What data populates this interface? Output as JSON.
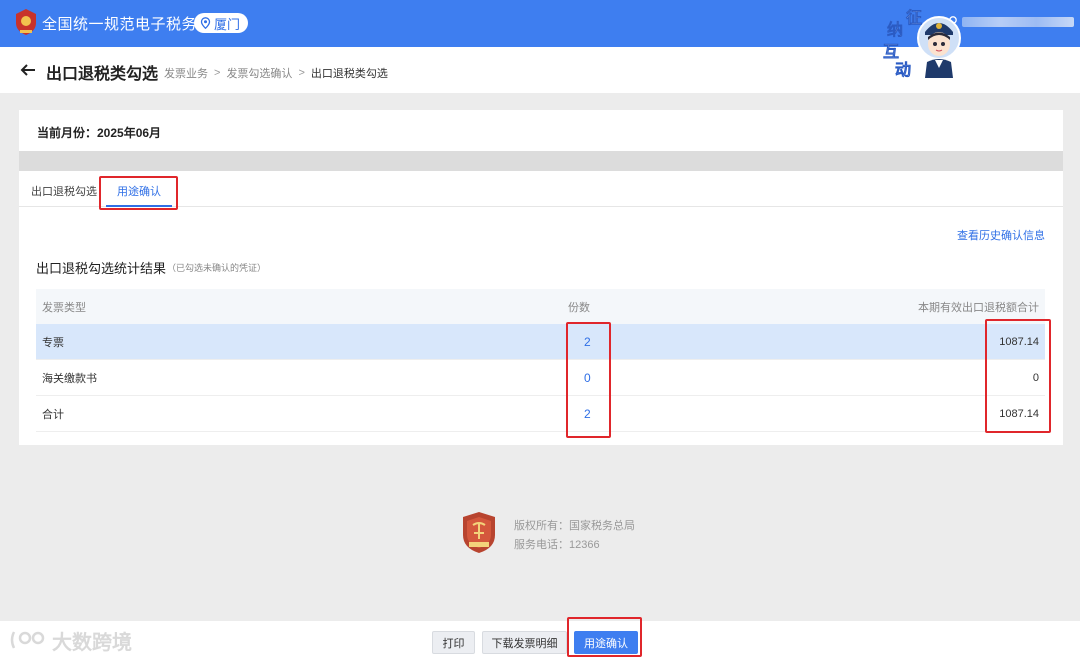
{
  "header": {
    "site_title": "全国统一规范电子税务局",
    "city": "厦门",
    "mascot_chars": [
      "征",
      "纳",
      "互",
      "动"
    ]
  },
  "page": {
    "title": "出口退税类勾选",
    "breadcrumb": [
      "发票业务",
      "发票勾选确认",
      "出口退税类勾选"
    ],
    "breadcrumb_sep": ">"
  },
  "month": {
    "label": "当前月份：2025年06月"
  },
  "tabs": [
    {
      "label": "出口退税勾选",
      "active": false
    },
    {
      "label": "用途确认",
      "active": true
    }
  ],
  "content": {
    "history_link": "查看历史确认信息",
    "stats_title": "出口退税勾选统计结果",
    "stats_subtitle": "（已勾选未确认的凭证）",
    "table": {
      "headers": [
        "发票类型",
        "份数",
        "本期有效出口退税额合计"
      ],
      "rows": [
        {
          "type": "专票",
          "count": "2",
          "amount": "1087.14",
          "selected": true
        },
        {
          "type": "海关缴款书",
          "count": "0",
          "amount": "0",
          "selected": false
        },
        {
          "type": "合计",
          "count": "2",
          "amount": "1087.14",
          "selected": false
        }
      ]
    }
  },
  "footer": {
    "copyright": "版权所有：国家税务总局",
    "phone": "服务电话：12366"
  },
  "actions": {
    "print": "打印",
    "download": "下载发票明细",
    "confirm": "用途确认"
  },
  "watermark": {
    "text": "大数跨境"
  },
  "colors": {
    "primary": "#3e7ef0",
    "link": "#2f6fe6",
    "annotation_red": "#e0262b",
    "selected_row": "#d8e7fb"
  }
}
